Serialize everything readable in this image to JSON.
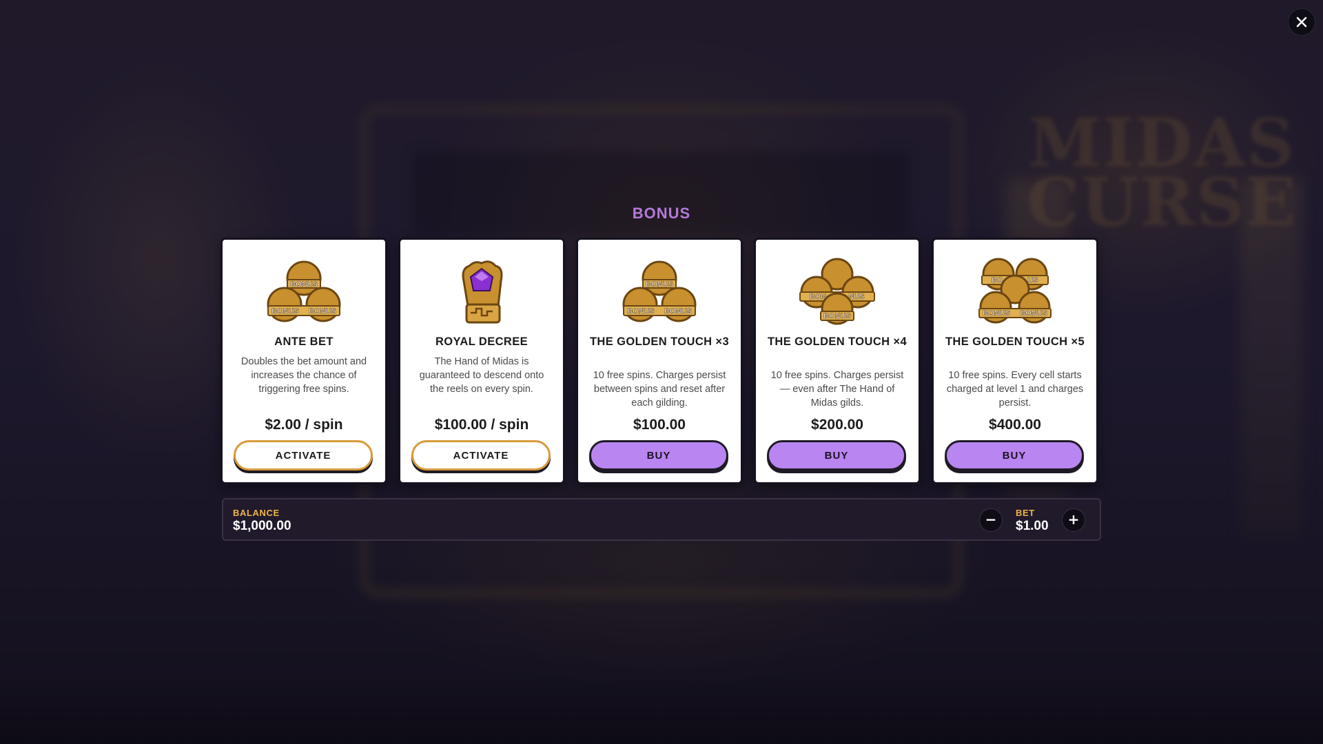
{
  "overlay": {
    "title": "BONUS",
    "close_icon": "close-icon"
  },
  "background": {
    "logo_text": "MIDAS CURSE"
  },
  "cards": [
    {
      "icon": "bonus-coins-3-icon",
      "title": "ANTE BET",
      "description": "Doubles the bet amount and increases the chance of triggering free spins.",
      "price": "$2.00 / spin",
      "button": "ACTIVATE",
      "button_style": "activate"
    },
    {
      "icon": "golden-hand-gem-icon",
      "title": "ROYAL DECREE",
      "description": "The Hand of Midas is guaranteed to descend onto the reels on every spin.",
      "price": "$100.00 / spin",
      "button": "ACTIVATE",
      "button_style": "activate"
    },
    {
      "icon": "bonus-coins-3-icon",
      "title": "THE GOLDEN TOUCH ×3",
      "description": "10 free spins. Charges persist between spins and reset after each gilding.",
      "price": "$100.00",
      "button": "BUY",
      "button_style": "buy"
    },
    {
      "icon": "bonus-coins-4-icon",
      "title": "THE GOLDEN TOUCH ×4",
      "description": "10 free spins. Charges persist — even after The Hand of Midas gilds.",
      "price": "$200.00",
      "button": "BUY",
      "button_style": "buy"
    },
    {
      "icon": "bonus-coins-5-icon",
      "title": "THE GOLDEN TOUCH ×5",
      "description": "10 free spins. Every cell starts charged at level 1 and charges persist.",
      "price": "$400.00",
      "button": "BUY",
      "button_style": "buy"
    }
  ],
  "balance": {
    "label": "BALANCE",
    "value": "$1,000.00"
  },
  "bet": {
    "label": "BET",
    "value": "$1.00",
    "minus_label": "−",
    "plus_label": "+"
  },
  "colors": {
    "accent_purple": "#b985f0",
    "title_purple": "#b57ad9",
    "gold": "#f0b548",
    "activate_border": "#d89a3a"
  }
}
